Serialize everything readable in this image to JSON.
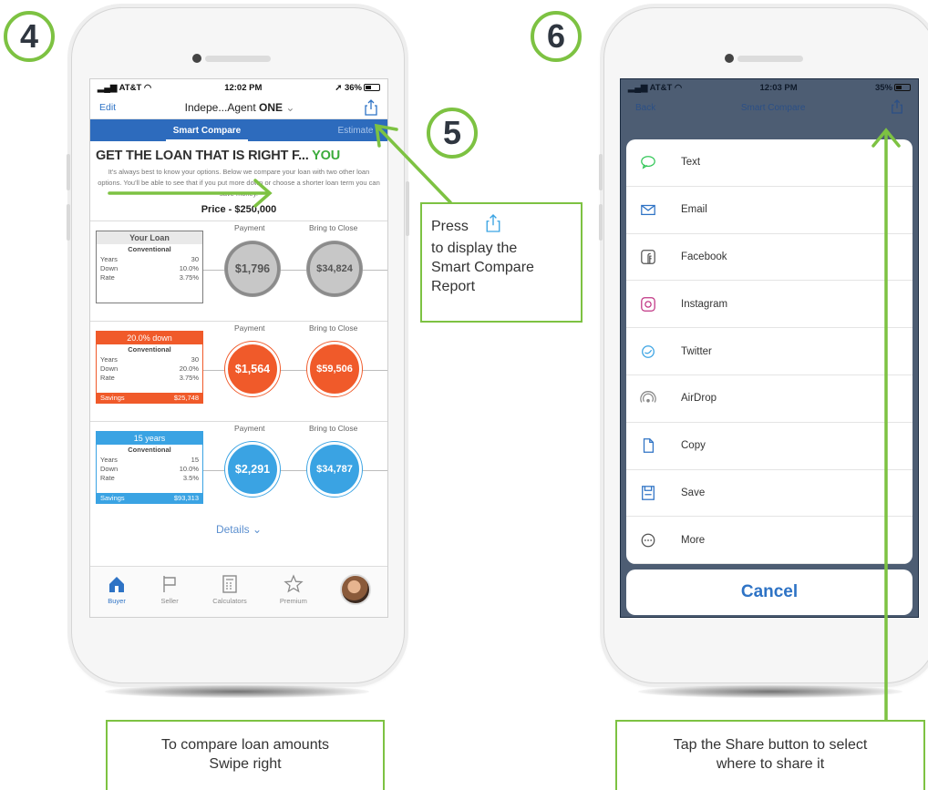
{
  "steps": [
    "4",
    "5",
    "6"
  ],
  "accent_color": "#7dc242",
  "left_phone": {
    "status": {
      "carrier": "AT&T",
      "time": "12:02 PM",
      "battery": "36%"
    },
    "nav": {
      "edit": "Edit",
      "title_prefix": "Indepe...Agent",
      "title_suffix": "ONE",
      "share_icon": "share-icon"
    },
    "tabs": {
      "active": "Smart Compare",
      "other": "Estimate"
    },
    "headline_main": "GET THE LOAN THAT IS RIGHT F...",
    "headline_accent": "YOU",
    "blurb": "It's always best to know your options. Below we compare your loan with two other loan options. You'll be able to see that if you put more down or choose a shorter loan term you can save money.",
    "price": "Price - $250,000",
    "col_payment": "Payment",
    "col_close": "Bring to Close",
    "loans": [
      {
        "caption": "Your Loan",
        "type": "Conventional",
        "years_label": "Years",
        "years": "30",
        "down_label": "Down",
        "down": "10.0%",
        "rate_label": "Rate",
        "rate": "3.75%",
        "payment": "$1,796",
        "close": "$34,824",
        "color": "#cfcfcf"
      },
      {
        "caption": "20.0% down",
        "type": "Conventional",
        "years_label": "Years",
        "years": "30",
        "down_label": "Down",
        "down": "20.0%",
        "rate_label": "Rate",
        "rate": "3.75%",
        "savings_label": "Savings",
        "savings": "$25,748",
        "payment": "$1,564",
        "close": "$59,506",
        "color": "#f05a2a"
      },
      {
        "caption": "15 years",
        "type": "Conventional",
        "years_label": "Years",
        "years": "15",
        "down_label": "Down",
        "down": "10.0%",
        "rate_label": "Rate",
        "rate": "3.5%",
        "savings_label": "Savings",
        "savings": "$93,313",
        "payment": "$2,291",
        "close": "$34,787",
        "color": "#3aa3e3"
      }
    ],
    "details": "Details",
    "bottom_tabs": [
      "Buyer",
      "Seller",
      "Calculators",
      "Premium"
    ]
  },
  "right_phone": {
    "status": {
      "carrier": "AT&T",
      "time": "12:03 PM",
      "battery": "35%"
    },
    "nav": {
      "back": "Back",
      "title": "Smart Compare"
    },
    "share_options": [
      {
        "label": "Text",
        "icon": "message-icon"
      },
      {
        "label": "Email",
        "icon": "mail-icon"
      },
      {
        "label": "Facebook",
        "icon": "facebook-icon"
      },
      {
        "label": "Instagram",
        "icon": "instagram-icon"
      },
      {
        "label": "Twitter",
        "icon": "twitter-icon"
      },
      {
        "label": "AirDrop",
        "icon": "airdrop-icon"
      },
      {
        "label": "Copy",
        "icon": "copy-icon"
      },
      {
        "label": "Save",
        "icon": "save-icon"
      },
      {
        "label": "More",
        "icon": "more-icon"
      }
    ],
    "cancel": "Cancel"
  },
  "callouts": {
    "press_word": "Press",
    "press_rest": [
      "to display the",
      "Smart Compare",
      "Report"
    ],
    "swipe": [
      "To compare loan amounts",
      "Swipe right"
    ],
    "share": [
      "Tap the Share button to select",
      "where to share it"
    ]
  }
}
